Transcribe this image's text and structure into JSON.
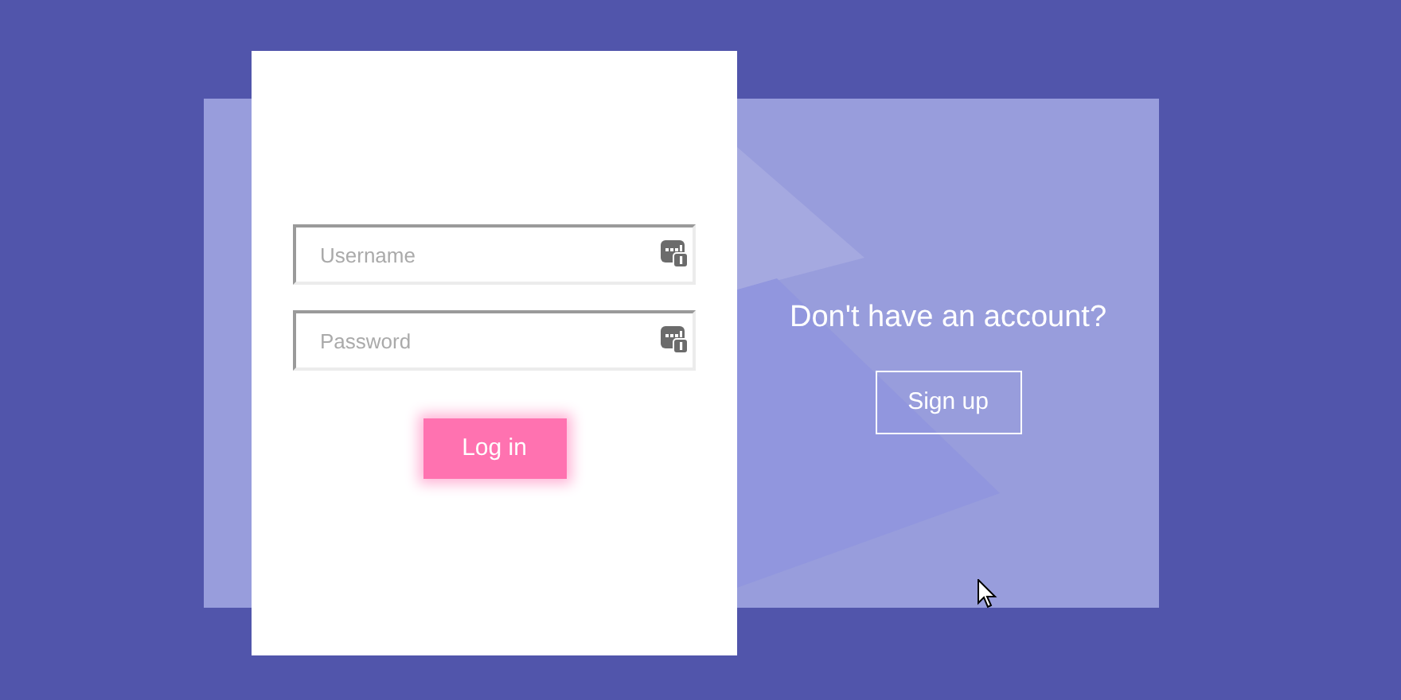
{
  "login_form": {
    "fields": [
      {
        "placeholder": "Username"
      },
      {
        "placeholder": "Password"
      }
    ],
    "submit_button": "Log in"
  },
  "signup_panel": {
    "prompt": "Don't have an account?",
    "button": "Sign up"
  }
}
